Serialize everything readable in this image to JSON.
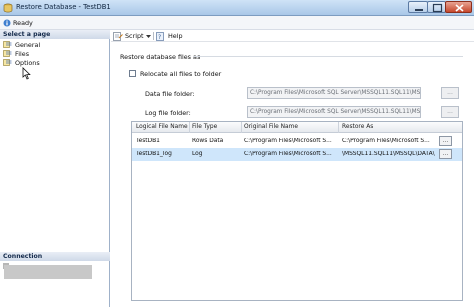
{
  "window": {
    "title": "Restore Database - TestDB1"
  },
  "status": {
    "text": "Ready"
  },
  "left_pane": {
    "select_page_header": "Select a page",
    "pages": [
      {
        "label": "General",
        "icon": "page-icon"
      },
      {
        "label": "Files",
        "icon": "page-icon"
      },
      {
        "label": "Options",
        "icon": "page-icon"
      }
    ],
    "connection_header": "Connection"
  },
  "toolbar": {
    "script_label": "Script",
    "help_label": "Help"
  },
  "main": {
    "section_label": "Restore database files as",
    "relocate_checkbox_label": "Relocate all files to folder",
    "relocate_checked": false,
    "data_folder_label": "Data file folder:",
    "data_folder_value": "C:\\Program Files\\Microsoft SQL Server\\MSSQL11.SQL11\\MSSQL",
    "log_folder_label": "Log file folder:",
    "log_folder_value": "C:\\Program Files\\Microsoft SQL Server\\MSSQL11.SQL11\\MSSQL",
    "browse_label": "..."
  },
  "grid": {
    "columns": [
      "Logical File Name",
      "File Type",
      "Original File Name",
      "Restore As"
    ],
    "rows": [
      {
        "logical": "TestDB1",
        "type": "Rows Data",
        "original": "C:\\Program Files\\Microsoft S...",
        "restore_as": "C:\\Program Files\\Microsoft S...",
        "button": "...",
        "selected": false
      },
      {
        "logical": "TestDB1_log",
        "type": "Log",
        "original": "C:\\Program Files\\Microsoft S...",
        "restore_as": "\\MSSQL11.SQL11\\MSSQL\\DATA\\",
        "button": "...",
        "selected": true
      }
    ]
  },
  "colors": {
    "selected_row": "#cfe6fb",
    "title_bar": "#a9c7e8",
    "close_button": "#c6482d"
  }
}
